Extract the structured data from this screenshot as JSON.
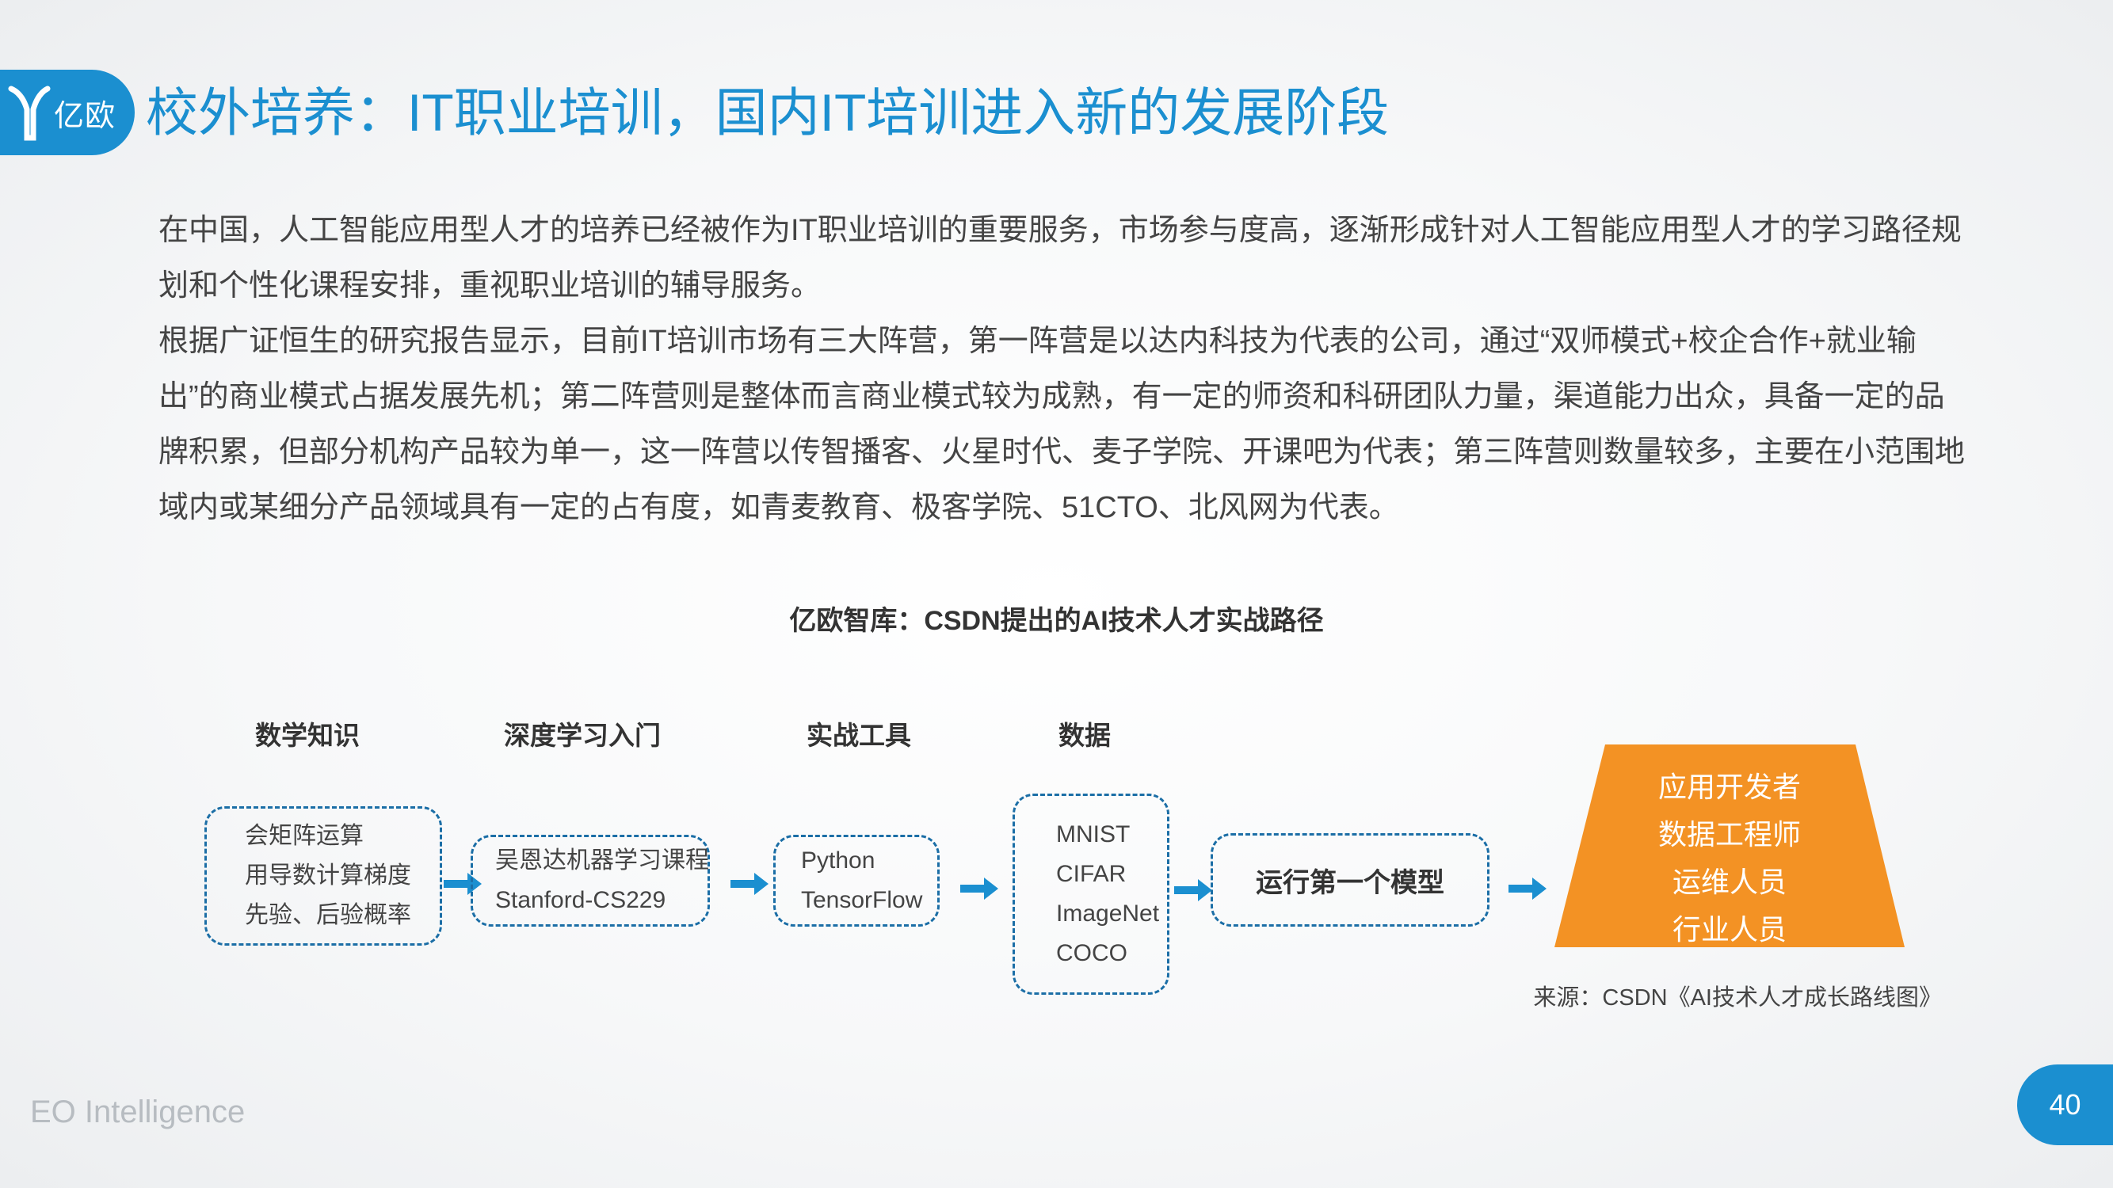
{
  "header": {
    "logo_text": "亿欧",
    "title": "校外培养：IT职业培训，国内IT培训进入新的发展阶段"
  },
  "body": {
    "paragraph1": "在中国，人工智能应用型人才的培养已经被作为IT职业培训的重要服务，市场参与度高，逐渐形成针对人工智能应用型人才的学习路径规划和个性化课程安排，重视职业培训的辅导服务。",
    "paragraph2": "根据广证恒生的研究报告显示，目前IT培训市场有三大阵营，第一阵营是以达内科技为代表的公司，通过“双师模式+校企合作+就业输出”的商业模式占据发展先机；第二阵营则是整体而言商业模式较为成熟，有一定的师资和科研团队力量，渠道能力出众，具备一定的品牌积累，但部分机构产品较为单一，这一阵营以传智播客、火星时代、麦子学院、开课吧为代表；第三阵营则数量较多，主要在小范围地域内或某细分产品领域具有一定的占有度，如青麦教育、极客学院、51CTO、北风网为代表。"
  },
  "figure": {
    "title": "亿欧智库：CSDN提出的AI技术人才实战路径",
    "stages": [
      {
        "label": "数学知识",
        "items": [
          "会矩阵运算",
          "用导数计算梯度",
          "先验、后验概率"
        ]
      },
      {
        "label": "深度学习入门",
        "items": [
          "吴恩达机器学习课程",
          "Stanford-CS229"
        ]
      },
      {
        "label": "实战工具",
        "items": [
          "Python",
          "TensorFlow"
        ]
      },
      {
        "label": "数据",
        "items": [
          "MNIST",
          "CIFAR",
          "ImageNet",
          "COCO"
        ]
      }
    ],
    "run_model": "运行第一个模型",
    "outcomes": [
      "应用开发者",
      "数据工程师",
      "运维人员",
      "行业人员"
    ],
    "source": "来源：CSDN《AI技术人才成长路线图》"
  },
  "colors": {
    "brand_blue": "#1b8fd0",
    "arrow_blue": "#1b8fd0",
    "box_border": "#1b6ea6",
    "pyramid_orange": "#f39224"
  },
  "footer": {
    "brand": "EO Intelligence",
    "page_number": "40"
  }
}
